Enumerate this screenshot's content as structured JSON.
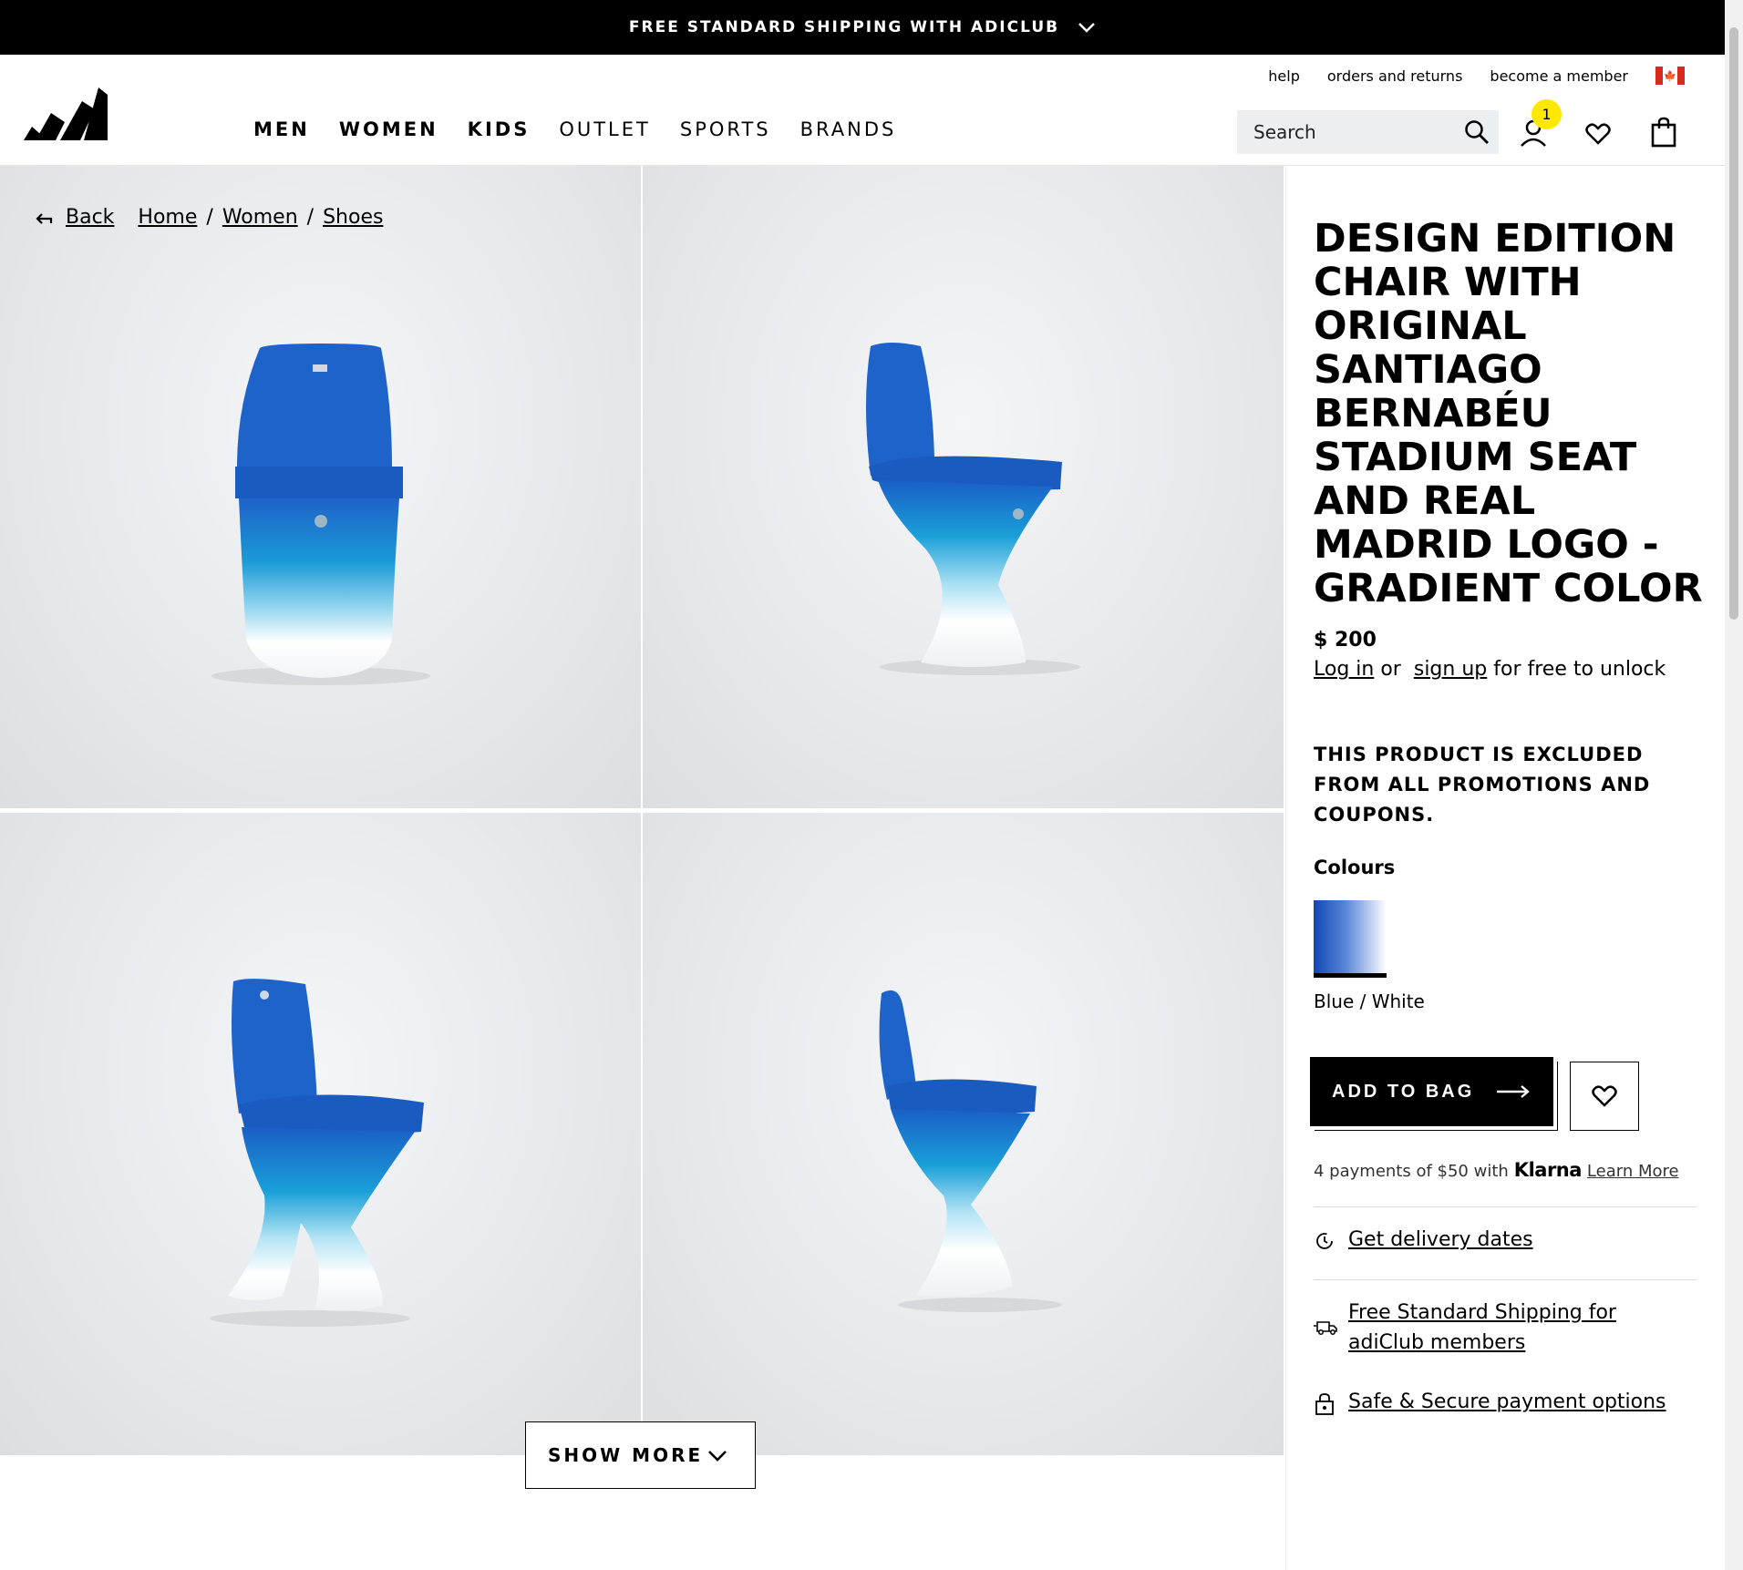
{
  "banner": {
    "text": "FREE STANDARD SHIPPING WITH ADICLUB"
  },
  "utility_links": [
    "help",
    "orders and returns",
    "become a member"
  ],
  "nav": {
    "items": [
      {
        "label": "MEN",
        "bold": true
      },
      {
        "label": "WOMEN",
        "bold": true
      },
      {
        "label": "KIDS",
        "bold": true
      },
      {
        "label": "OUTLET",
        "bold": false
      },
      {
        "label": "SPORTS",
        "bold": false
      },
      {
        "label": "BRANDS",
        "bold": false
      }
    ]
  },
  "search": {
    "placeholder": "Search"
  },
  "account": {
    "badge_count": "1"
  },
  "breadcrumb": {
    "back": "Back",
    "items": [
      "Home",
      "Women",
      "Shoes"
    ]
  },
  "gallery": {
    "show_more": "SHOW MORE"
  },
  "product": {
    "title": "DESIGN EDITION CHAIR WITH ORIGINAL SANTIAGO BERNABÉU STADIUM SEAT AND REAL MADRID LOGO - GRADIENT COLOR",
    "price": "$ 200",
    "unlock": {
      "login": "Log in",
      "or": "or",
      "signup": "sign up",
      "rest": "for free to unlock"
    },
    "excluded_notice": "THIS PRODUCT IS EXCLUDED FROM ALL PROMOTIONS AND COUPONS.",
    "colours_heading": "Colours",
    "colour_name": "Blue / White",
    "add_to_bag": "ADD TO BAG",
    "klarna": {
      "text": "4 payments of $50 with",
      "brand": "Klarna",
      "link": "Learn More"
    },
    "info": {
      "delivery": "Get delivery dates",
      "shipping": "Free Standard Shipping for adiClub members",
      "payment": "Safe & Secure payment options"
    }
  },
  "colors": {
    "accent": "#000000",
    "badge": "#ffe800",
    "swatch_blue": "#1246b4"
  }
}
